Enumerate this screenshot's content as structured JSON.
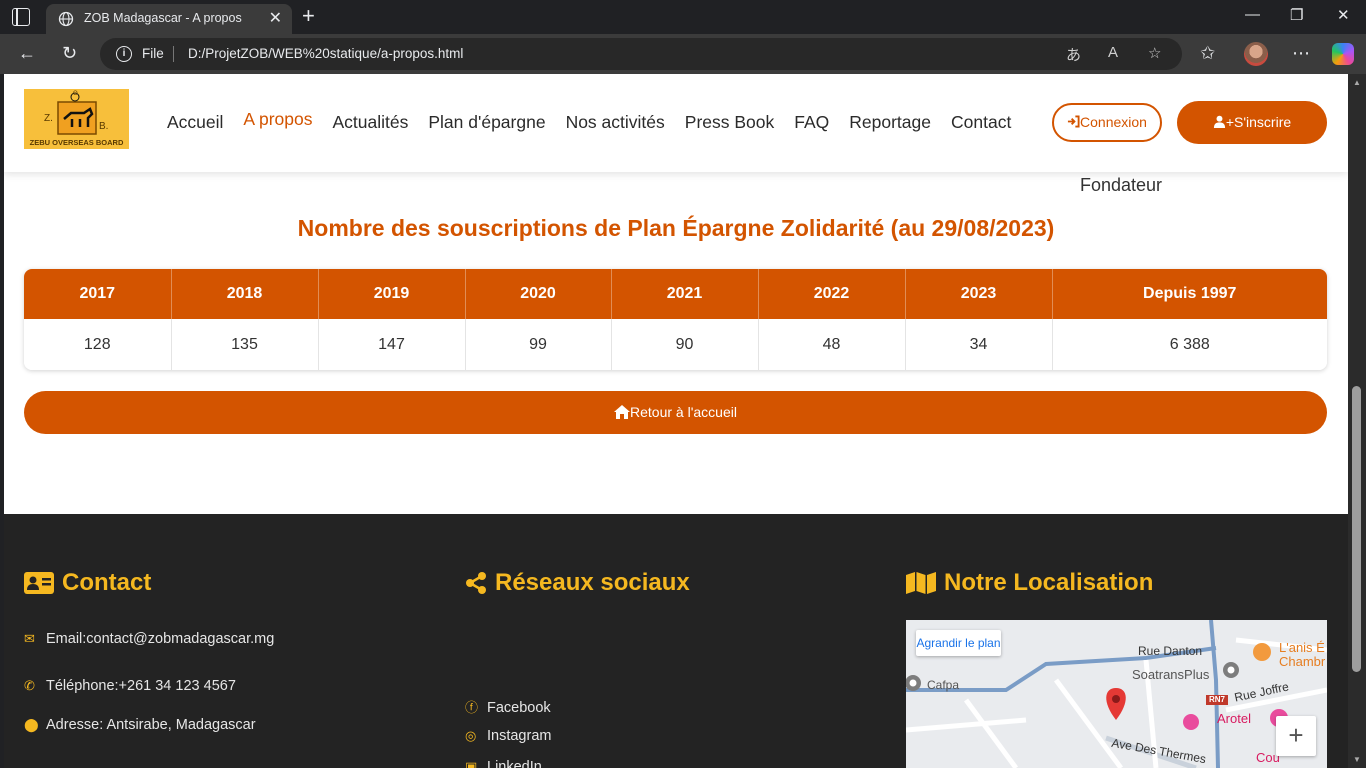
{
  "browser": {
    "tab_title": "ZOB Madagascar - A propos",
    "url_scheme": "File",
    "url": "D:/ProjetZOB/WEB%20statique/a-propos.html"
  },
  "header": {
    "logo_text": "ZEBU OVERSEAS BOARD",
    "logo_letters": [
      "Z.",
      "O",
      "B."
    ],
    "nav": [
      "Accueil",
      "A propos",
      "Actualités",
      "Plan d'épargne",
      "Nos activités",
      "Press Book",
      "FAQ",
      "Reportage",
      "Contact"
    ],
    "active_nav": "A propos",
    "login_label": "Connexion",
    "signup_label": "+S'inscrire"
  },
  "content": {
    "founder_label": "Fondateur",
    "section_title": "Nombre des souscriptions de Plan Épargne Zolidarité (au 29/08/2023)",
    "table": {
      "headers": [
        "2017",
        "2018",
        "2019",
        "2020",
        "2021",
        "2022",
        "2023",
        "Depuis 1997"
      ],
      "values": [
        "128",
        "135",
        "147",
        "99",
        "90",
        "48",
        "34",
        "6 388"
      ]
    },
    "back_label": "Retour à l'accueil"
  },
  "footer": {
    "contact_title": "Contact",
    "email": "Email:contact@zobmadagascar.mg",
    "phone": "Téléphone:+261 34 123 4567",
    "address": "Adresse: Antsirabe, Madagascar",
    "social_title": "Réseaux sociaux",
    "social": [
      "Facebook",
      "Instagram",
      "LinkedIn"
    ],
    "location_title": "Notre Localisation",
    "map": {
      "enlarge_label": "Agrandir le plan",
      "zoom_label": "+",
      "labels": [
        "Rue Danton",
        "SoatransPlus",
        "Cafpa",
        "RN7",
        "Rue Joffre",
        "Arotel",
        "Ave Des Thermes",
        "L'anis É",
        "Chambr",
        "Cou"
      ]
    }
  },
  "colors": {
    "accent": "#d35400",
    "footer_bg": "#232323",
    "footer_accent": "#f5b820"
  }
}
